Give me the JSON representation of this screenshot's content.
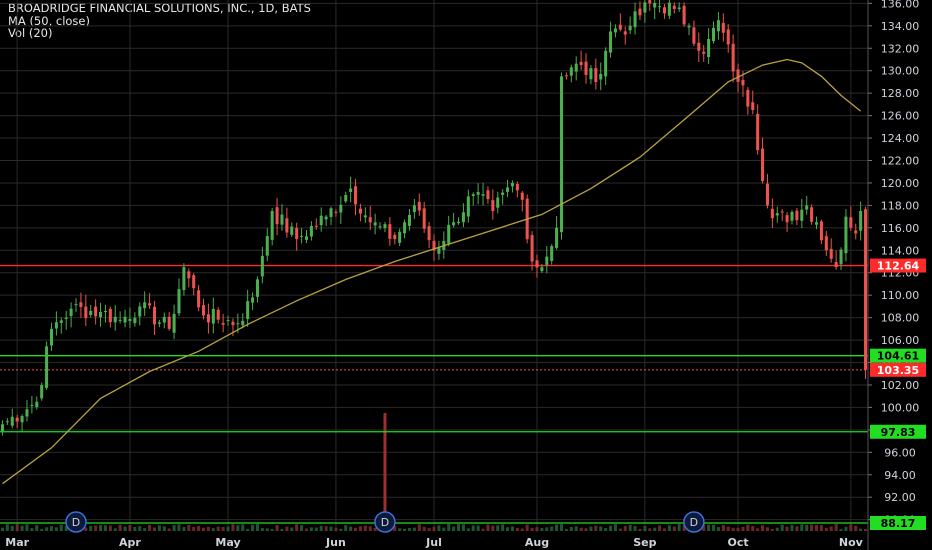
{
  "legend": {
    "symbol": "BROADRIDGE FINANCIAL SOLUTIONS, INC., 1D, BATS",
    "ma": "MA (50, close)",
    "vol": "Vol (20)"
  },
  "colors": {
    "background": "#000000",
    "grid": "#2a2a2a",
    "up": "#4caf50",
    "down": "#ef5350",
    "ma": "#b9a33f",
    "red_line": "#ff2b2b",
    "green_line": "#22dd22"
  },
  "chart_data": {
    "type": "candlestick",
    "x_ticks": [
      {
        "label": "Mar",
        "i": 3
      },
      {
        "label": "Apr",
        "i": 26
      },
      {
        "label": "May",
        "i": 46
      },
      {
        "label": "Jun",
        "i": 68
      },
      {
        "label": "Jul",
        "i": 88
      },
      {
        "label": "Aug",
        "i": 109
      },
      {
        "label": "Sep",
        "i": 131
      },
      {
        "label": "Oct",
        "i": 150
      },
      {
        "label": "Nov",
        "i": 173
      }
    ],
    "y_ticks": [
      90,
      92,
      94,
      96,
      98,
      100,
      102,
      104,
      106,
      108,
      110,
      112,
      114,
      116,
      118,
      120,
      122,
      124,
      126,
      128,
      130,
      132,
      134,
      136
    ],
    "ylim": [
      88.9,
      136.3
    ],
    "x_count": 177,
    "levels": [
      {
        "value": 112.64,
        "label": "112.64",
        "color": "red"
      },
      {
        "value": 104.61,
        "label": "104.61",
        "color": "green"
      },
      {
        "value": 97.83,
        "label": "97.83",
        "color": "green"
      }
    ],
    "last_price": {
      "value": 103.35,
      "label": "103.35"
    },
    "volume_badge": {
      "label": "88.17"
    },
    "dividend_markers": {
      "label": "D",
      "i": [
        15,
        78,
        141
      ]
    },
    "ma_points": [
      [
        0,
        93.2
      ],
      [
        10,
        96.4
      ],
      [
        20,
        100.8
      ],
      [
        30,
        103.2
      ],
      [
        40,
        105.0
      ],
      [
        50,
        107.4
      ],
      [
        60,
        109.5
      ],
      [
        70,
        111.4
      ],
      [
        80,
        113.0
      ],
      [
        90,
        114.4
      ],
      [
        100,
        115.8
      ],
      [
        110,
        117.2
      ],
      [
        120,
        119.5
      ],
      [
        130,
        122.3
      ],
      [
        140,
        126.0
      ],
      [
        148,
        129.0
      ],
      [
        155,
        130.5
      ],
      [
        160,
        131.0
      ],
      [
        163,
        130.7
      ],
      [
        167,
        129.5
      ],
      [
        171,
        127.8
      ],
      [
        175,
        126.4
      ]
    ],
    "key_closes": [
      [
        0,
        98.5
      ],
      [
        7,
        100.5
      ],
      [
        10,
        107.0
      ],
      [
        14,
        108.8
      ],
      [
        20,
        108.5
      ],
      [
        24,
        107.8
      ],
      [
        28,
        109.0
      ],
      [
        34,
        107.0
      ],
      [
        37,
        112.5
      ],
      [
        41,
        108.2
      ],
      [
        48,
        107.5
      ],
      [
        51,
        109.8
      ],
      [
        53,
        113.5
      ],
      [
        55,
        117.5
      ],
      [
        60,
        115.0
      ],
      [
        66,
        117.0
      ],
      [
        71,
        119.5
      ],
      [
        75,
        116.5
      ],
      [
        80,
        115.0
      ],
      [
        84,
        118.0
      ],
      [
        88,
        114.0
      ],
      [
        92,
        116.5
      ],
      [
        96,
        119.0
      ],
      [
        100,
        117.5
      ],
      [
        104,
        120.0
      ],
      [
        106,
        118.5
      ],
      [
        108,
        113.0
      ],
      [
        110,
        112.5
      ],
      [
        113,
        116.0
      ],
      [
        114,
        129.5
      ],
      [
        118,
        130.5
      ],
      [
        121,
        129.0
      ],
      [
        124,
        133.5
      ],
      [
        128,
        134.0
      ],
      [
        132,
        136.0
      ],
      [
        137,
        135.5
      ],
      [
        140,
        134.0
      ],
      [
        143,
        131.5
      ],
      [
        146,
        134.5
      ],
      [
        150,
        129.0
      ],
      [
        153,
        126.5
      ],
      [
        156,
        118.0
      ],
      [
        160,
        116.5
      ],
      [
        164,
        118.0
      ],
      [
        166,
        116.5
      ],
      [
        168,
        114.0
      ],
      [
        170,
        112.5
      ],
      [
        172,
        117.0
      ],
      [
        174,
        115.5
      ],
      [
        175,
        117.5
      ],
      [
        176,
        103.35
      ]
    ],
    "volume_spike": {
      "i": 78,
      "value": 99.5
    }
  }
}
